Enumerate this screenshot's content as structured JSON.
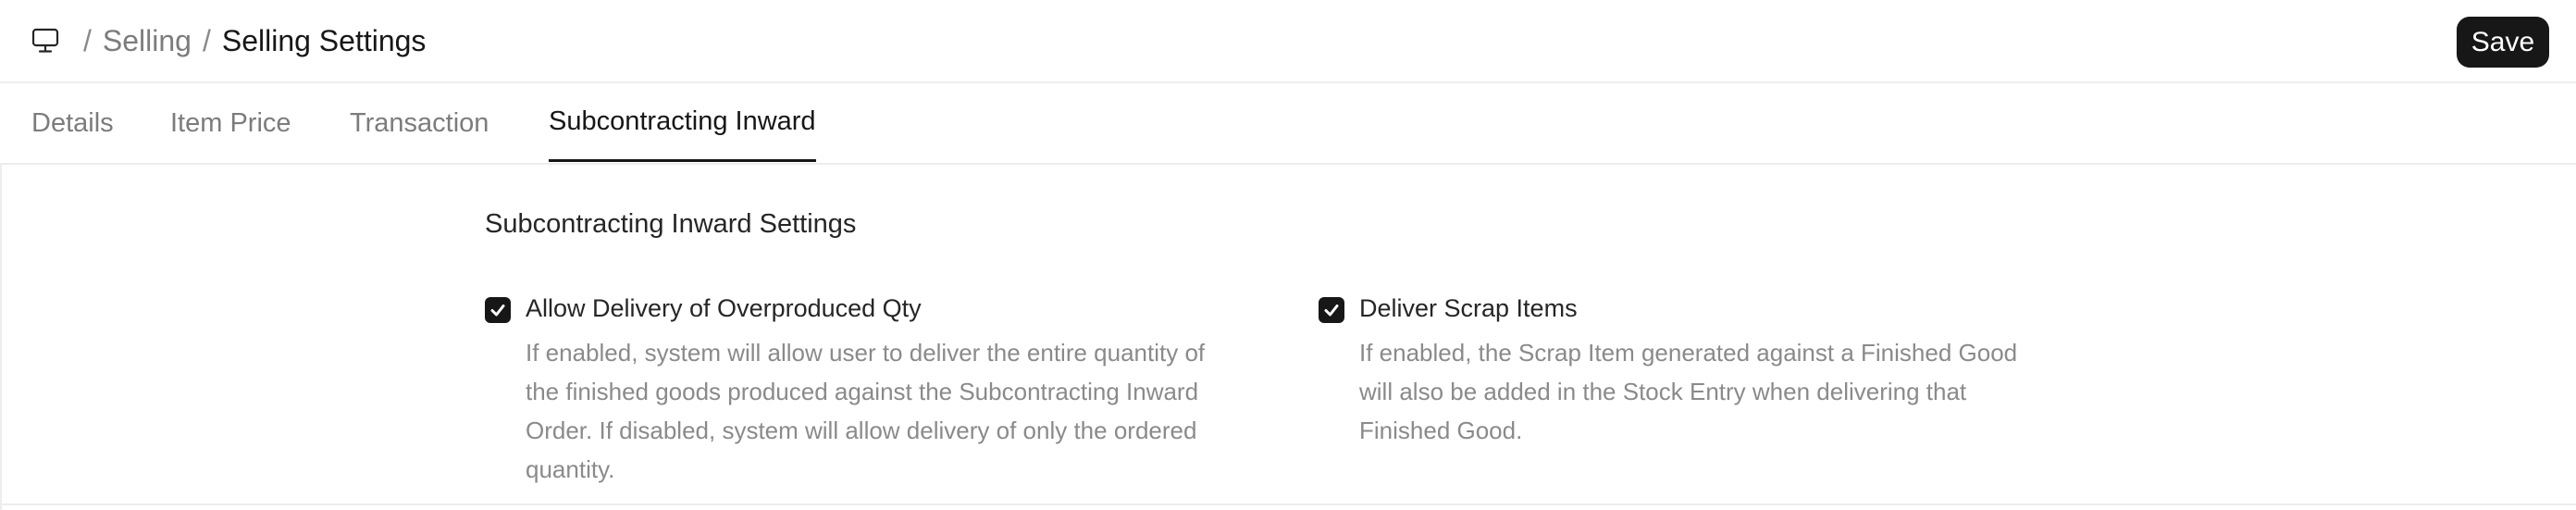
{
  "breadcrumb": {
    "icon": "monitor-icon",
    "separator": "/",
    "parent": "Selling",
    "current": "Selling Settings"
  },
  "header": {
    "save_label": "Save"
  },
  "tabs": [
    {
      "label": "Details",
      "active": false
    },
    {
      "label": "Item Price",
      "active": false
    },
    {
      "label": "Transaction",
      "active": false
    },
    {
      "label": "Subcontracting Inward",
      "active": true
    }
  ],
  "section": {
    "title": "Subcontracting Inward Settings",
    "fields": [
      {
        "label": "Allow Delivery of Overproduced Qty",
        "checked": true,
        "description_lines": [
          "If enabled, system will allow user to deliver the entire quantity of",
          "the finished goods produced against the Subcontracting Inward",
          "Order. If disabled, system will allow delivery of only the ordered",
          "quantity."
        ]
      },
      {
        "label": "Deliver Scrap Items",
        "checked": true,
        "description_lines": [
          "If enabled, the Scrap Item generated against a Finished Good",
          "will also be added in the Stock Entry when delivering that",
          "Finished Good."
        ]
      }
    ]
  },
  "colors": {
    "accent": "#171717",
    "muted_text": "#7c7c7c",
    "description_text": "#8a8a8a",
    "border": "#ededed"
  }
}
